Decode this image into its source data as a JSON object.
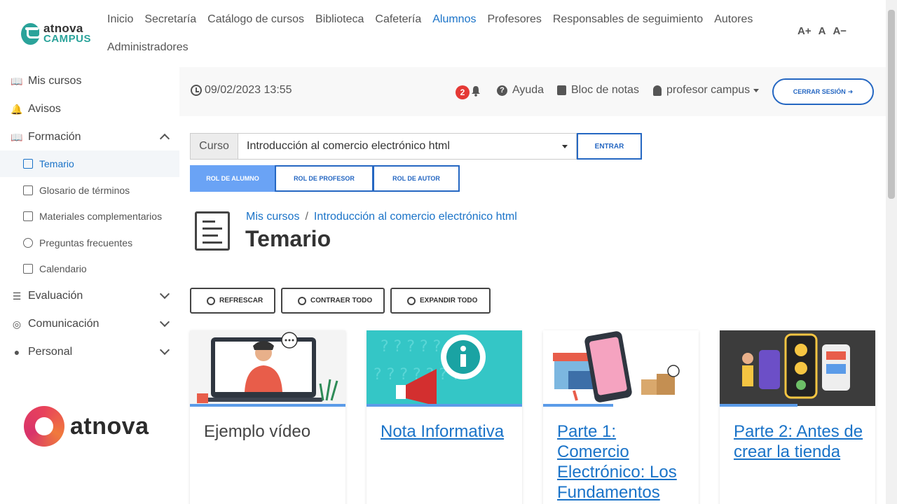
{
  "brand": {
    "line1": "atnova",
    "line2": "CAMPUS",
    "footer": "atnova"
  },
  "topnav": [
    "Inicio",
    "Secretaría",
    "Catálogo de cursos",
    "Biblioteca",
    "Cafetería",
    "Alumnos",
    "Profesores",
    "Responsables de seguimiento",
    "Autores",
    "Administradores"
  ],
  "topnav_active": "Alumnos",
  "font_controls": {
    "increase": "A+",
    "normal": "A",
    "decrease": "A−"
  },
  "sidebar": {
    "mis_cursos": "Mis cursos",
    "avisos": "Avisos",
    "formacion": "Formación",
    "sub": [
      "Temario",
      "Glosario de términos",
      "Materiales complementarios",
      "Preguntas frecuentes",
      "Calendario"
    ],
    "evaluacion": "Evaluación",
    "comunicacion": "Comunicación",
    "personal": "Personal"
  },
  "header": {
    "datetime": "09/02/2023 13:55",
    "notifications": "2",
    "help": "Ayuda",
    "notes": "Bloc de notas",
    "user": "profesor campus",
    "logout": "CERRAR SESIÓN"
  },
  "course": {
    "label": "Curso",
    "selected": "Introducción al comercio electrónico html",
    "enter": "ENTRAR"
  },
  "roles": [
    "ROL DE ALUMNO",
    "ROL DE PROFESOR",
    "ROL DE AUTOR"
  ],
  "breadcrumb": [
    "Mis cursos",
    "Introducción al comercio electrónico html"
  ],
  "page_title": "Temario",
  "actions": [
    "REFRESCAR",
    "CONTRAER TODO",
    "EXPANDIR TODO"
  ],
  "cards": [
    {
      "title": "Ejemplo vídeo",
      "progress": 1.0
    },
    {
      "title": "Nota Informativa",
      "progress": 1.0
    },
    {
      "title": "Parte 1: Comercio Electrónico: Los Fundamentos",
      "progress": 0.45
    },
    {
      "title": "Parte 2: Antes de crear la tienda",
      "progress": 0.5
    }
  ],
  "colors": {
    "accent": "#2567c2",
    "link": "#1a73c8",
    "brand_teal": "#2aa39a",
    "role_active": "#6aa3f5",
    "badge": "#e53935"
  }
}
